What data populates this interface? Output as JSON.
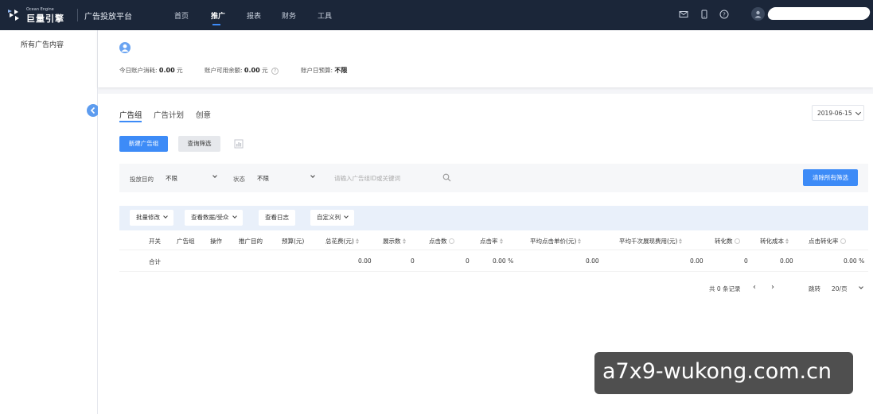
{
  "brand": {
    "logo_en": "Ocean Engine",
    "logo_cn": "巨量引擎",
    "platform": "广告投放平台"
  },
  "nav": {
    "items": [
      {
        "label": "首页",
        "active": false
      },
      {
        "label": "推广",
        "active": true
      },
      {
        "label": "报表",
        "active": false
      },
      {
        "label": "财务",
        "active": false
      },
      {
        "label": "工具",
        "active": false
      }
    ],
    "icons": [
      "mail-icon",
      "mobile-icon",
      "help-icon",
      "user-icon"
    ]
  },
  "sidebar": {
    "items": [
      {
        "label": "所有广告内容"
      }
    ]
  },
  "account": {
    "spend_label": "今日账户消耗:",
    "spend_value": "0.00",
    "spend_unit": "元",
    "balance_label": "账户可用余额:",
    "balance_value": "0.00",
    "balance_unit": "元",
    "budget_label": "账户日预算:",
    "budget_value": "不限"
  },
  "tabs": [
    {
      "label": "广告组",
      "active": true
    },
    {
      "label": "广告计划",
      "active": false
    },
    {
      "label": "创意",
      "active": false
    }
  ],
  "date_picker": {
    "value": "2019-06-15"
  },
  "actions": {
    "new_group": "新建广告组",
    "query_filter": "查询筛选"
  },
  "filters": {
    "goal_label": "投放目的",
    "goal_value": "不限",
    "status_label": "状态",
    "status_value": "不限",
    "search_placeholder": "请输入广告组ID或关键词",
    "clear_button": "清除所有筛选"
  },
  "table_tools": {
    "batch_edit": "批量修改",
    "view_data": "查看数据/受众",
    "view_log": "查看日志",
    "custom_columns": "自定义列"
  },
  "table": {
    "columns": [
      "开关",
      "广告组",
      "操作",
      "推广目的",
      "预算(元)",
      "总花费(元)",
      "展示数",
      "点击数",
      "点击率",
      "平均点击单价(元)",
      "平均千次展现费用(元)",
      "转化数",
      "转化成本",
      "点击转化率"
    ],
    "total_row": {
      "label": "合计",
      "cost": "0.00",
      "show": "0",
      "click": "0",
      "ctr": "0.00 %",
      "avg_click_cost": "0.00",
      "avg_cpm": "0.00",
      "convert": "0",
      "convert_cost": "0.00",
      "convert_rate": "0.00 %"
    }
  },
  "pagination": {
    "total": "共 0 条记录",
    "prev": "‹",
    "next": "›",
    "jump_label": "跳转",
    "page_size": "20/页"
  },
  "watermark": {
    "text": "a7x9-wukong.com.cn"
  }
}
